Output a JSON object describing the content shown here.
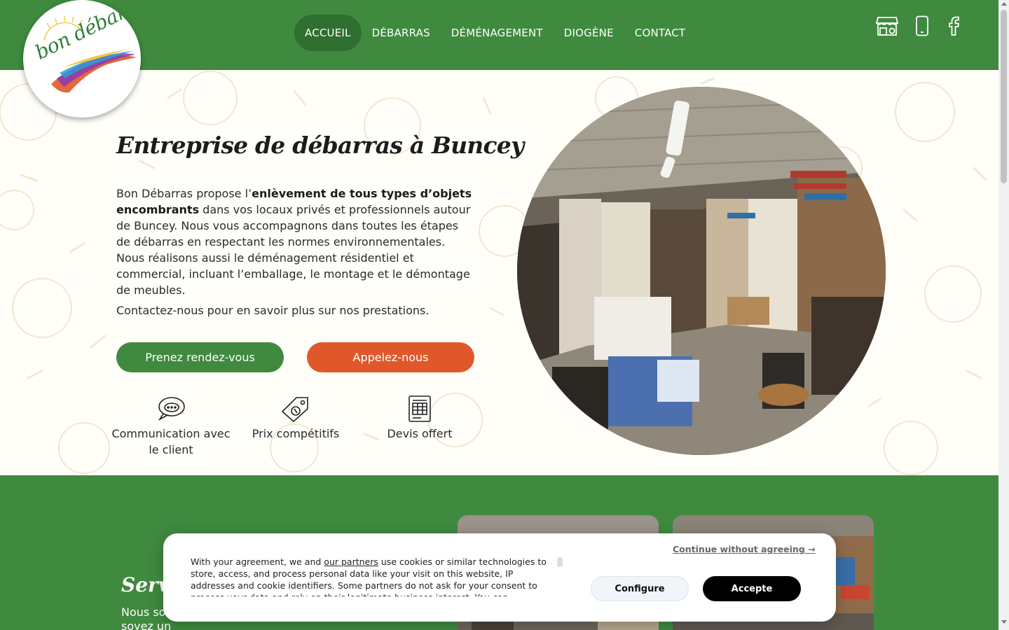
{
  "logo": {
    "text": "bon débarras"
  },
  "nav": {
    "items": [
      {
        "label": "ACCUEIL",
        "active": true
      },
      {
        "label": "DÉBARRAS",
        "active": false
      },
      {
        "label": "DÉMÉNAGEMENT",
        "active": false
      },
      {
        "label": "DIOGÈNE",
        "active": false
      },
      {
        "label": "CONTACT",
        "active": false
      }
    ]
  },
  "header_icons": [
    "store-icon",
    "phone-icon",
    "facebook-icon"
  ],
  "hero": {
    "title": "Entreprise de débarras à Buncey",
    "para_1": "Bon Débarras propose l’",
    "para_bold": "enlèvement de tous types d’objets encombrants",
    "para_2": " dans vos locaux privés et professionnels autour de Buncey. Nous vous accompagnons dans toutes les étapes de débarras en respectant les normes environnementales. Nous réalisons aussi le déménagement résidentiel et commercial, incluant l’emballage, le montage et le démontage de meubles.",
    "contact_line": "Contactez-nous pour en savoir plus sur nos prestations.",
    "btn_appointment": "Prenez rendez-vous",
    "btn_call": "Appelez-nous",
    "features": [
      {
        "icon": "chat-bubble-icon",
        "label": "Communication avec le client"
      },
      {
        "icon": "price-tag-icon",
        "label": "Prix compétitifs"
      },
      {
        "icon": "quote-document-icon",
        "label": "Devis offert"
      }
    ]
  },
  "services": {
    "title": "Servi",
    "text": "Nous so besoins en débarras, que vous soyez un"
  },
  "cookie": {
    "text_before_link": "With your agreement, we and ",
    "link": "our partners",
    "text_after_link": " use cookies or similar technologies to store, access, and process personal data like your visit on this website, IP addresses and cookie identifiers. Some partners do not ask for your consent to process your data and rely on their legitimate business interest. You can",
    "continue": "Continue without agreeing →",
    "configure": "Configure",
    "accept": "Accepte"
  },
  "colors": {
    "green": "#3f8a3f",
    "green_dark": "#2f6f30",
    "orange": "#e0582a",
    "accept_bg": "#000000"
  }
}
